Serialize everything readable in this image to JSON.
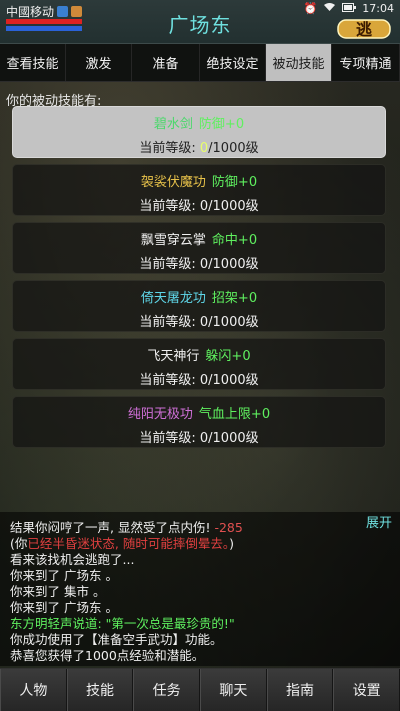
{
  "status_bar": {
    "carrier": "中國移动",
    "time": "17:04",
    "battery_icon": "battery-icon",
    "wifi_icon": "wifi-icon",
    "alarm_icon": "alarm-icon"
  },
  "header": {
    "title": "广场东",
    "logo_text": "逃"
  },
  "tabs": [
    {
      "label": "查看技能",
      "active": false
    },
    {
      "label": "激发",
      "active": false
    },
    {
      "label": "准备",
      "active": false
    },
    {
      "label": "绝技设定",
      "active": false
    },
    {
      "label": "被动技能",
      "active": true
    },
    {
      "label": "专项精通",
      "active": false
    }
  ],
  "section_label": "你的被动技能有:",
  "skills": [
    {
      "name": "碧水剑",
      "effect": "防御+0",
      "level_prefix": "当前等级: ",
      "level": "0",
      "level_suffix": "/1000级",
      "selected": true
    },
    {
      "name": "袈裟伏魔功",
      "effect": "防御+0",
      "level_prefix": "当前等级: ",
      "level": "0",
      "level_suffix": "/1000级",
      "selected": false
    },
    {
      "name": "飘雪穿云掌",
      "effect": "命中+0",
      "level_prefix": "当前等级: ",
      "level": "0",
      "level_suffix": "/1000级",
      "selected": false
    },
    {
      "name": "倚天屠龙功",
      "effect": "招架+0",
      "level_prefix": "当前等级: ",
      "level": "0",
      "level_suffix": "/1000级",
      "selected": false
    },
    {
      "name": "飞天神行",
      "effect": "躲闪+0",
      "level_prefix": "当前等级: ",
      "level": "0",
      "level_suffix": "/1000级",
      "selected": false
    },
    {
      "name": "纯阳无极功",
      "effect": "气血上限+0",
      "level_prefix": "当前等级: ",
      "level": "0",
      "level_suffix": "/1000级",
      "selected": false
    }
  ],
  "skill_name_colors": [
    "#49d86a",
    "#e8c24a",
    "#f0f0f0",
    "#5fd6e8",
    "#f0f0f0",
    "#d070d8"
  ],
  "expand_label": "展开",
  "log": {
    "line1_text": "结果你闷哼了一声, 显然受了点内伤!",
    "line1_damage": "-285",
    "line2_open": "(你",
    "line2_red": "已经半昏迷状态, 随时可能摔倒晕去。",
    "line2_close": ")",
    "line3": "看来该找机会逃跑了...",
    "line4": "你来到了 广场东 。",
    "line5": "你来到了 集市 。",
    "line6": "你来到了 广场东 。",
    "line7": "东方明轻声说道: \"第一次总是最珍贵的!\"",
    "line8": "你成功使用了【准备空手武功】功能。",
    "line9": "恭喜您获得了1000点经验和潜能。"
  },
  "bottom_nav": [
    "人物",
    "技能",
    "任务",
    "聊天",
    "指南",
    "设置"
  ]
}
